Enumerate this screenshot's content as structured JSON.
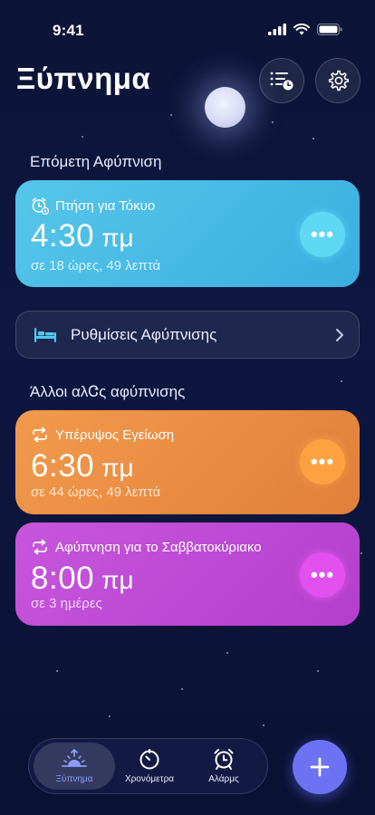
{
  "status_bar": {
    "time": "9:41"
  },
  "header": {
    "title": "Ξύπνημα"
  },
  "next_alarm": {
    "section_label": "Επόμετη Αφύπνιση",
    "name": "Πτήση για Τόκυο",
    "time": "4:30",
    "ampm": "πμ",
    "countdown": "σε 18 ώρες, 49 λεπτά",
    "more_label": "•••",
    "color": "#4bbbe6"
  },
  "wake_settings": {
    "label": "Ρυθμίσεις Αφύπνισης"
  },
  "other_alarms": {
    "section_label": "Άλλοι αλᏣς αφύπνισης",
    "items": [
      {
        "name": "Υπέρυψος Εγείωση",
        "time": "6:30",
        "ampm": "πμ",
        "countdown": "σε 44 ώρες, 49 λεπτά",
        "more_label": "•••",
        "color": "#ea8c43"
      },
      {
        "name": "Αφύπνηση για το Σαββατοκύριακο",
        "time": "8:00",
        "ampm": "πμ",
        "countdown": "σε 3 ημέρες",
        "more_label": "•••",
        "color": "#bf4bd4"
      }
    ]
  },
  "tabbar": {
    "tabs": [
      {
        "label": "Ξύπνημα",
        "icon": "sunrise-icon",
        "active": true
      },
      {
        "label": "Χρονόμετρα",
        "icon": "timer-icon",
        "active": false
      },
      {
        "label": "Αλάρμς",
        "icon": "alarm-clock-icon",
        "active": false
      }
    ]
  },
  "fab": {
    "icon": "plus-icon"
  },
  "colors": {
    "background": "#0c1538",
    "accent": "#6c72f2",
    "active_tab": "#8d9bff"
  }
}
